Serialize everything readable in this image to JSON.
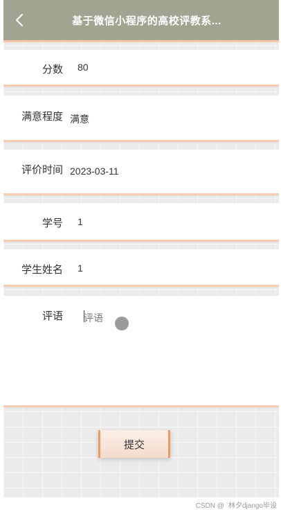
{
  "header": {
    "title": "基于微信小程序的高校评教系...",
    "back_icon": "chevron-left-icon"
  },
  "form": {
    "score": {
      "label": "分数",
      "value": "80"
    },
    "satisfaction": {
      "label": "满意程度",
      "value": "满意"
    },
    "eval_time": {
      "label": "评价时间",
      "value": "2023-03-11"
    },
    "student_id": {
      "label": "学号",
      "value": "1"
    },
    "student_name": {
      "label": "学生姓名",
      "value": "1"
    },
    "comment": {
      "label": "评语",
      "placeholder": "评语"
    }
  },
  "submit_label": "提交",
  "watermark": "CSDN @ `林夕django毕设",
  "colors": {
    "header_bg": "#a2a391",
    "accent": "#f7cdb2",
    "button_border": "#ee9a62"
  }
}
